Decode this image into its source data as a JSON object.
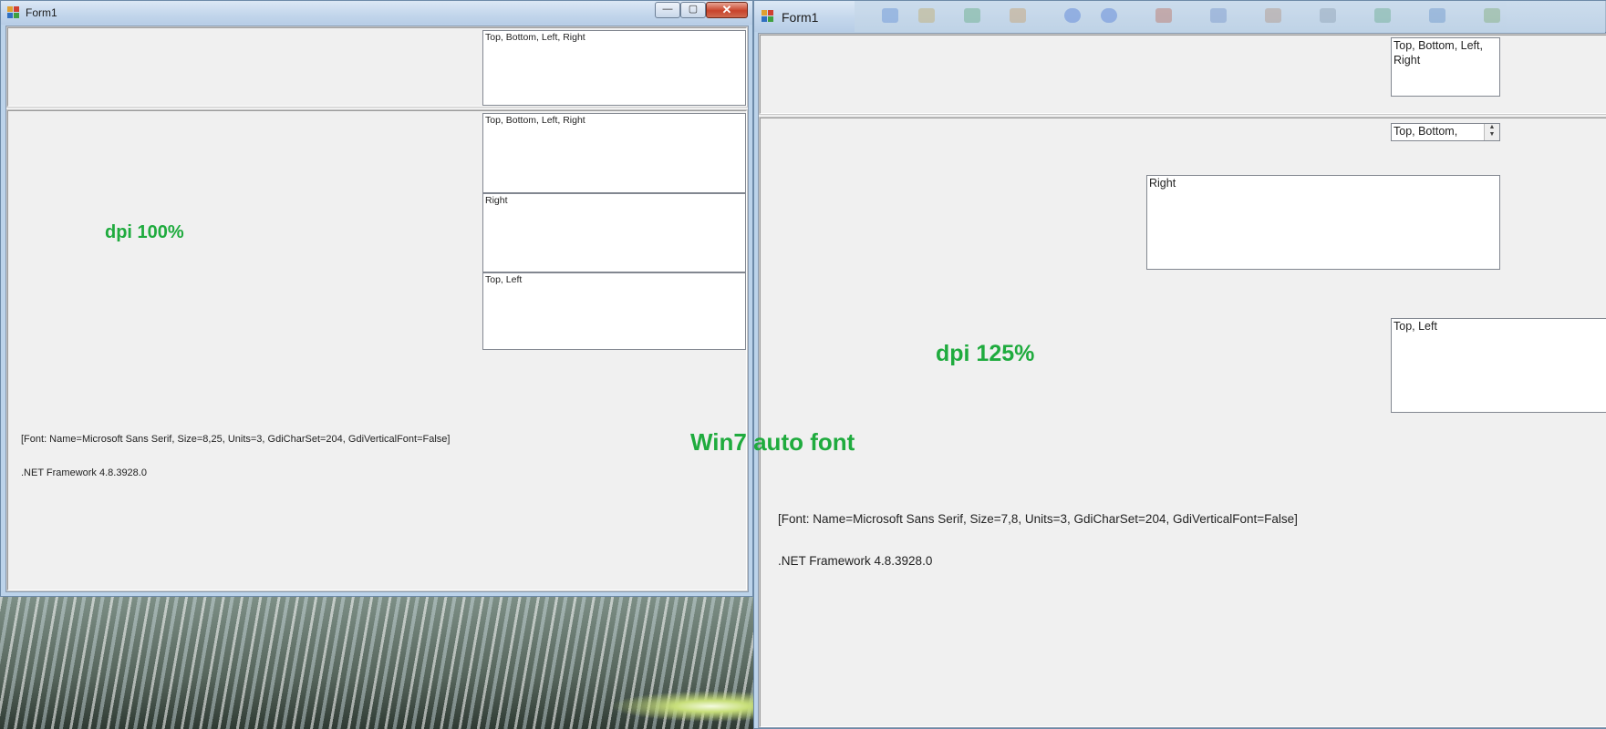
{
  "left_window": {
    "title": "Form1",
    "top_panel_box": "Top, Bottom, Left, Right",
    "boxes": [
      "Top, Bottom, Left, Right",
      "Right",
      "Top, Left"
    ],
    "dpi_label": "dpi 100%",
    "font_info": "[Font: Name=Microsoft Sans Serif, Size=8,25, Units=3, GdiCharSet=204, GdiVerticalFont=False]",
    "framework": ".NET Framework 4.8.3928.0",
    "minimize_glyph": "—",
    "maximize_glyph": "▢",
    "close_glyph": "✕"
  },
  "right_window": {
    "title": "Form1",
    "top_panel_box": "Top, Bottom, Left, Right",
    "small_box": "Top, Bottom,",
    "box_right": "Right",
    "box_top_left": "Top, Left",
    "dpi_label": "dpi 125%",
    "font_info": "[Font: Name=Microsoft Sans Serif, Size=7,8, Units=3, GdiCharSet=204, GdiVerticalFont=False]",
    "framework": ".NET Framework 4.8.3928.0"
  },
  "center_label": "Win7 auto font",
  "colors": {
    "label_green": "#1fab3e",
    "form_background": "#f0f0f0",
    "aero_frame": "#bcd3ea"
  }
}
